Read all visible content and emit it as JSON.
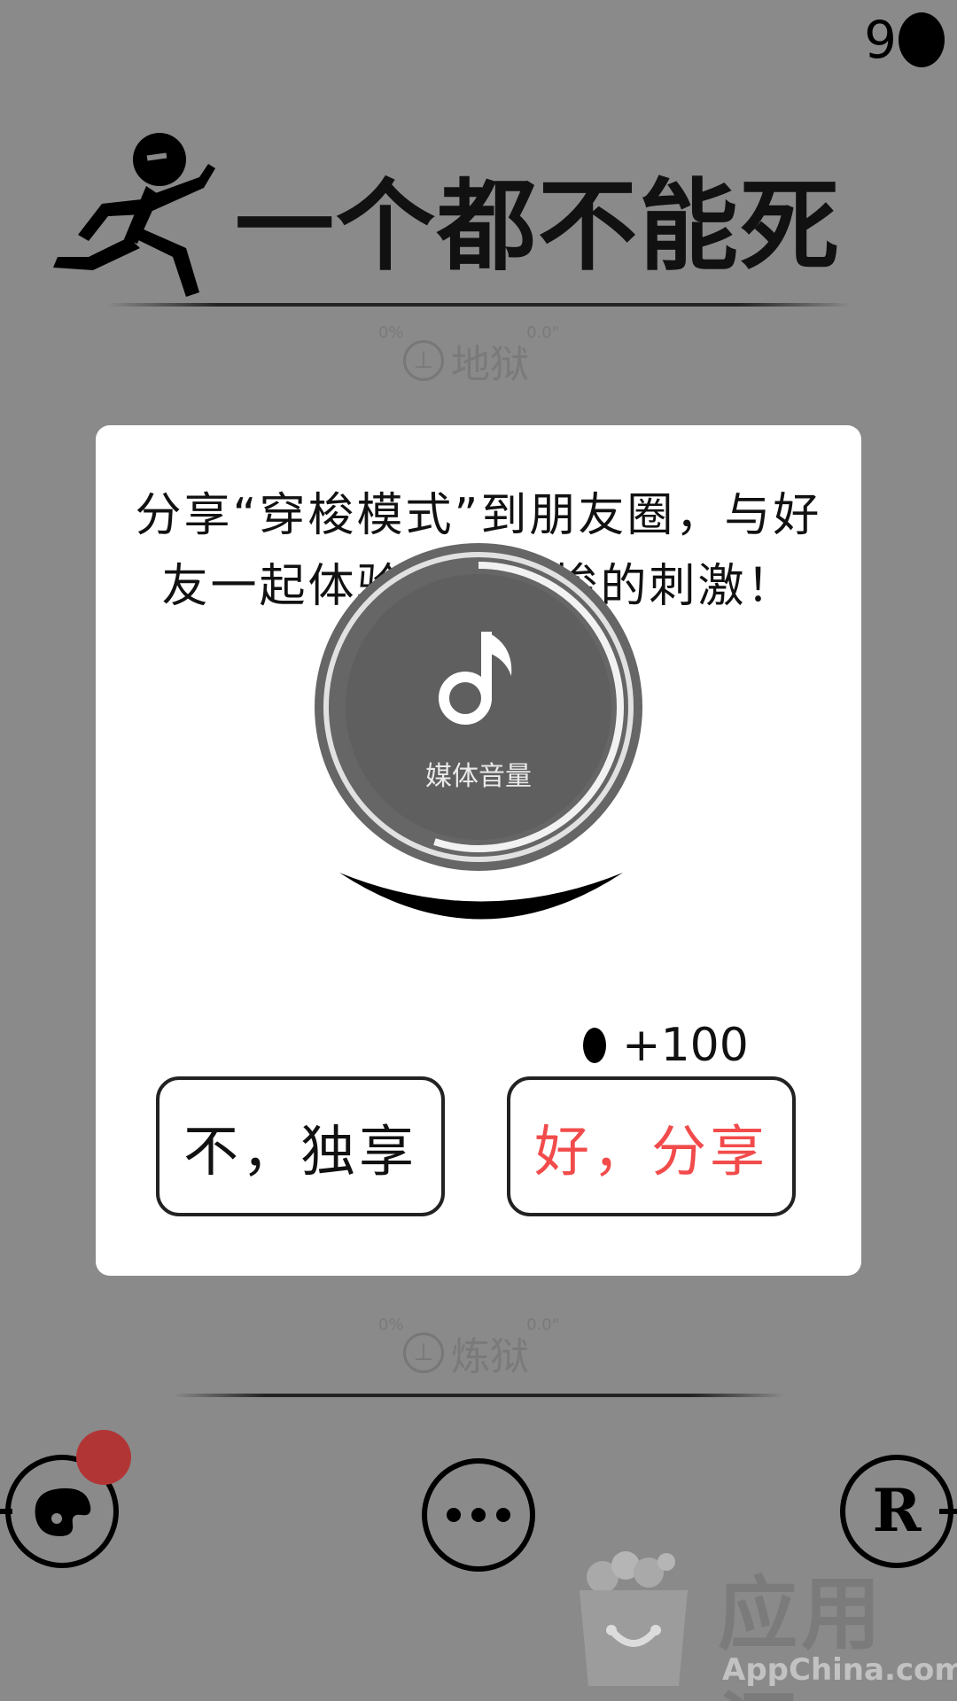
{
  "header": {
    "coins": "9",
    "game_title": "一个都不能死"
  },
  "modes": {
    "hell": {
      "label": "地狱",
      "percent": "0%",
      "score": "0.0\""
    },
    "purgatory": {
      "label": "炼狱",
      "percent": "0%",
      "score": "0.0\""
    }
  },
  "dialog": {
    "message": "分享“穿梭模式”到朋友圈，与好友一起体验云端穿梭的刺激！(送100金币)",
    "reward": "+100",
    "decline_label": "不，独享",
    "accept_label": "好，分享"
  },
  "volume_overlay": {
    "label": "媒体音量",
    "level": 0.55,
    "icon": "music-note-icon"
  },
  "bottom_bar": {
    "left_icon": "palette-icon",
    "center_icon": "more-icon",
    "right_icon": "r-letter-icon",
    "right_letter": "R",
    "notification_color": "#b23535"
  },
  "watermark": {
    "title": "应用汇",
    "subtitle": "AppChina.com"
  },
  "colors": {
    "background": "#8a8a8a",
    "accept": "#f24b4b",
    "overlay": "#666666"
  }
}
